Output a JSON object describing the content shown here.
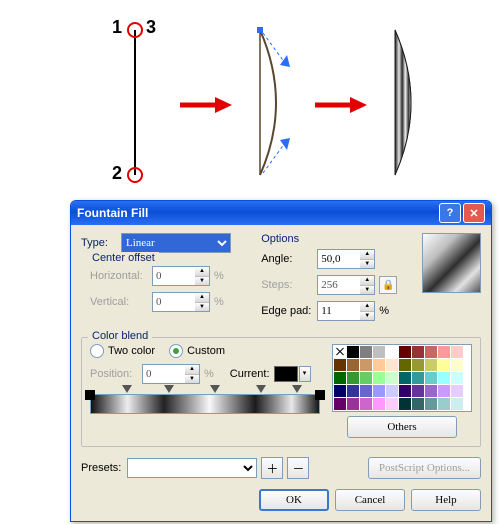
{
  "illustration": {
    "labels": {
      "p1": "1",
      "p2": "2",
      "p3": "3"
    }
  },
  "dialog": {
    "title": "Fountain Fill",
    "type_label": "Type:",
    "type_value": "Linear",
    "center_offset": {
      "caption": "Center offset",
      "horizontal_label": "Horizontal:",
      "horizontal_value": "0",
      "vertical_label": "Vertical:",
      "vertical_value": "0",
      "pct": "%"
    },
    "options": {
      "caption": "Options",
      "angle_label": "Angle:",
      "angle_value": "50,0",
      "steps_label": "Steps:",
      "steps_value": "256",
      "edgepad_label": "Edge pad:",
      "edgepad_value": "11",
      "pct": "%"
    },
    "color_blend": {
      "caption": "Color blend",
      "two_color_label": "Two color",
      "custom_label": "Custom",
      "position_label": "Position:",
      "position_value": "0",
      "pct": "%",
      "current_label": "Current:"
    },
    "palette_colors": [
      "X",
      "#000000",
      "#7f7f7f",
      "#bfbfbf",
      "#ffffff",
      "#660000",
      "#993333",
      "#cc6666",
      "#ff9999",
      "#ffcccc",
      "#663300",
      "#996633",
      "#cc9966",
      "#ffcc99",
      "#ffe6cc",
      "#666600",
      "#999933",
      "#cccc66",
      "#ffff99",
      "#ffffcc",
      "#006600",
      "#339933",
      "#66cc66",
      "#99ff99",
      "#ccffcc",
      "#006666",
      "#339999",
      "#66cccc",
      "#99ffff",
      "#ccffff",
      "#000066",
      "#333399",
      "#6666cc",
      "#9999ff",
      "#ccccff",
      "#330066",
      "#663399",
      "#9966cc",
      "#cc99ff",
      "#e6ccff",
      "#660066",
      "#993399",
      "#cc66cc",
      "#ff99ff",
      "#ffccff",
      "#003333",
      "#336666",
      "#669999",
      "#99cccc",
      "#cceeee"
    ],
    "others_label": "Others",
    "presets_label": "Presets:",
    "presets_value": "",
    "postscript_label": "PostScript Options...",
    "ok_label": "OK",
    "cancel_label": "Cancel",
    "help_label": "Help"
  }
}
